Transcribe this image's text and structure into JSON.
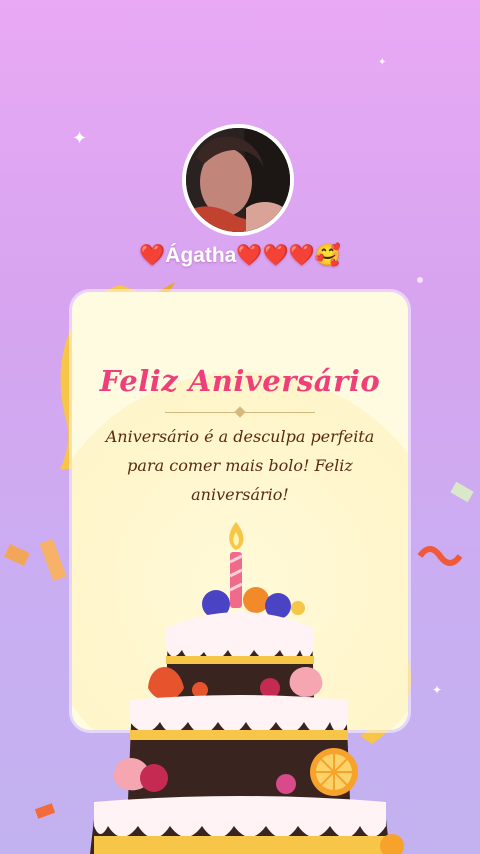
{
  "profile": {
    "name": "❤️Ágatha❤️❤️❤️🥰"
  },
  "card": {
    "title": "Feliz Aniversário",
    "message": "Aniversário é a desculpa perfeita para comer mais bolo! Feliz aniversário!"
  },
  "colors": {
    "background_top": "#e9a9f4",
    "background_bottom": "#c3b2f0",
    "card": "#fffbe0",
    "title": "#ee3f7a",
    "message": "#5a2a0e",
    "ribbon": "#f7c548"
  }
}
